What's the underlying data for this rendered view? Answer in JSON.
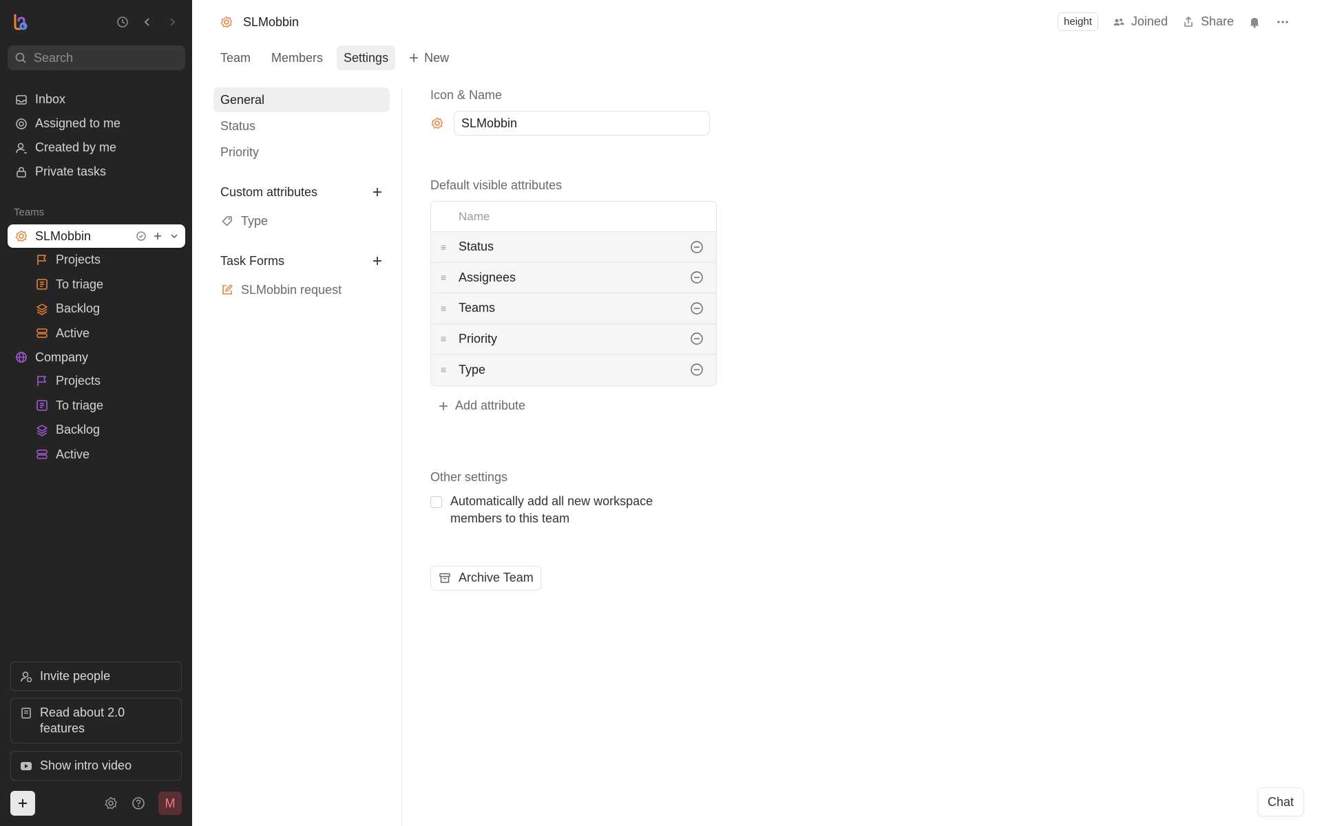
{
  "sidebar": {
    "search_placeholder": "Search",
    "nav": [
      {
        "label": "Inbox",
        "icon": "inbox-icon"
      },
      {
        "label": "Assigned to me",
        "icon": "target-icon"
      },
      {
        "label": "Created by me",
        "icon": "user-icon"
      },
      {
        "label": "Private tasks",
        "icon": "lock-icon"
      }
    ],
    "teams_heading": "Teams",
    "teams": [
      {
        "name": "SLMobbin",
        "color": "#e8833a",
        "items": [
          "Projects",
          "To triage",
          "Backlog",
          "Active"
        ]
      },
      {
        "name": "Company",
        "color": "#a45bd6",
        "items": [
          "Projects",
          "To triage",
          "Backlog",
          "Active"
        ]
      }
    ],
    "bottom": {
      "invite": "Invite people",
      "read_about": "Read about 2.0 features",
      "intro_video": "Show intro video",
      "avatar_initial": "M"
    }
  },
  "header": {
    "title": "SLMobbin",
    "badge": "height",
    "joined": "Joined",
    "share": "Share"
  },
  "tabs": [
    {
      "label": "Team",
      "active": false
    },
    {
      "label": "Members",
      "active": false
    },
    {
      "label": "Settings",
      "active": true
    },
    {
      "label": "New",
      "active": false
    }
  ],
  "settings_nav": {
    "items": [
      "General",
      "Status",
      "Priority"
    ],
    "custom_attributes": {
      "title": "Custom attributes",
      "items": [
        "Type"
      ]
    },
    "task_forms": {
      "title": "Task Forms",
      "items": [
        "SLMobbin request"
      ]
    }
  },
  "content": {
    "icon_name_label": "Icon & Name",
    "team_name": "SLMobbin",
    "default_visible_label": "Default visible attributes",
    "table_header": "Name",
    "attributes": [
      "Status",
      "Assignees",
      "Teams",
      "Priority",
      "Type"
    ],
    "add_attribute": "Add attribute",
    "other_settings_label": "Other settings",
    "auto_add_text": "Automatically add all new workspace members to this team",
    "archive_button": "Archive Team"
  },
  "chat_button": "Chat",
  "colors": {
    "sidebar_bg": "#242424",
    "accent_orange": "#e8833a",
    "accent_purple": "#a45bd6"
  }
}
